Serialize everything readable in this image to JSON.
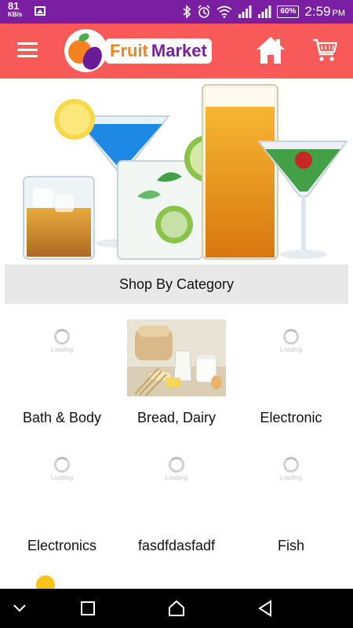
{
  "status_bar": {
    "net_speed": "81",
    "net_unit": "KB/s",
    "battery": "60%",
    "time": "2:59",
    "ampm": "PM"
  },
  "app_bar": {
    "logo_word1": "Fruit",
    "logo_word2": "Market",
    "brand_color": "#f85a59"
  },
  "category": {
    "header": "Shop By Category",
    "loading_text": "Loading",
    "items": [
      {
        "label": "Bath & Body",
        "image": "loading"
      },
      {
        "label": "Bread, Dairy",
        "image": "bread-dairy-photo"
      },
      {
        "label": "Electronic",
        "image": "loading"
      },
      {
        "label": "Electronics",
        "image": "loading"
      },
      {
        "label": "fasdfdasfadf",
        "image": "loading"
      },
      {
        "label": "Fish",
        "image": "loading"
      }
    ]
  },
  "icons": {
    "menu": "hamburger-icon",
    "home": "home-icon",
    "cart": "cart-icon",
    "nav_back": "back-triangle-icon",
    "nav_home": "home-outline-icon",
    "nav_recent": "square-icon",
    "nav_down": "chevron-down-icon"
  }
}
